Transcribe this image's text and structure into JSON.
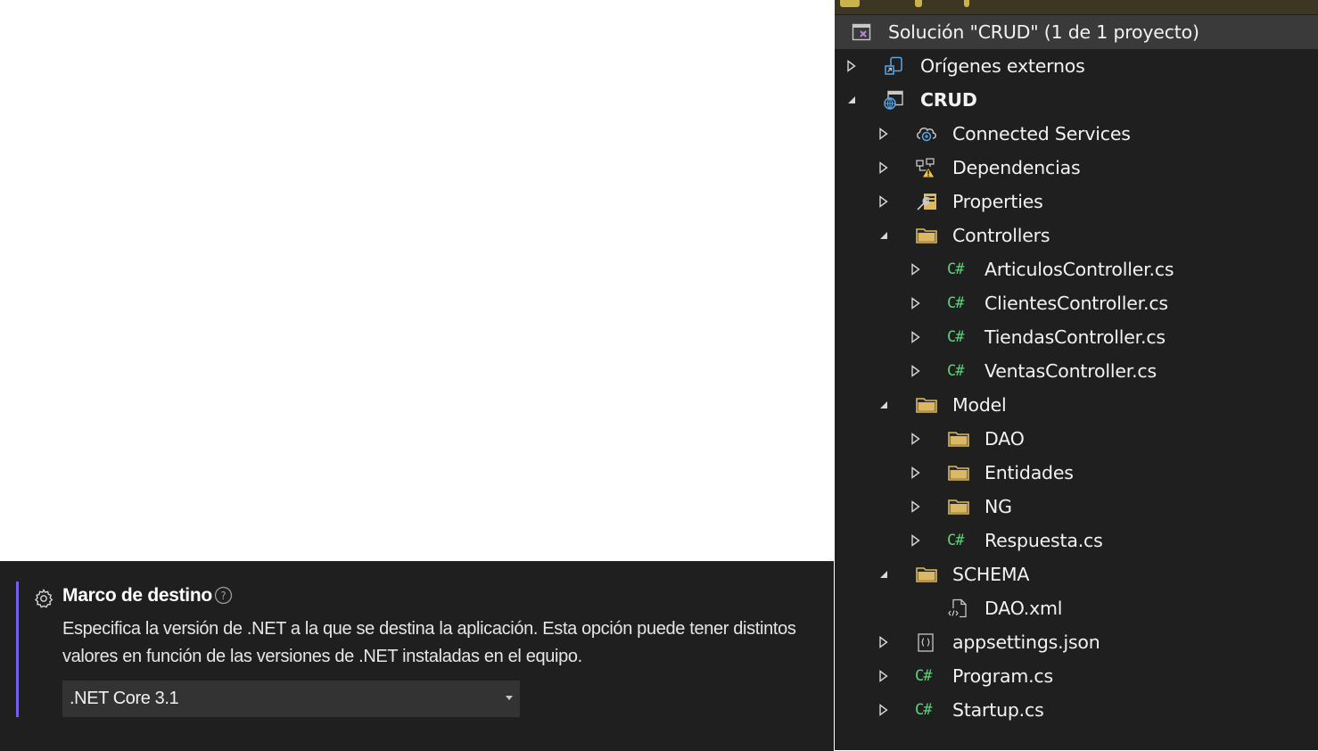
{
  "framework": {
    "title": "Marco de destino",
    "description_line1": "Especifica la versión de .NET a la que se destina la aplicación. Esta opción puede tener distintos",
    "description_line2": "valores en función de las versiones de .NET instaladas en el equipo.",
    "selected_value": ".NET Core 3.1",
    "icons": {
      "settings": "gear-icon",
      "help": "help-icon",
      "dropdown": "chevron-down-icon"
    },
    "colors": {
      "accent": "#7160e8",
      "background": "#1f1f1f",
      "select_bg": "#333333"
    }
  },
  "solution_explorer": {
    "colors": {
      "background": "#1f1f1f",
      "selected_row": "#3a3a3a",
      "folder": "#dcb862",
      "csharp": "#5fd17a"
    },
    "tree": [
      {
        "label": "Solución \"CRUD\"  (1 de 1 proyecto)",
        "icon": "solution-icon",
        "expander": "none",
        "bold": false,
        "selected": true
      },
      {
        "label": "Orígenes externos",
        "icon": "external-sources-icon",
        "expander": "collapsed",
        "bold": false
      },
      {
        "label": "CRUD",
        "icon": "web-project-icon",
        "expander": "expanded",
        "bold": true
      },
      {
        "label": "Connected Services",
        "icon": "connected-services-icon",
        "expander": "collapsed",
        "bold": false
      },
      {
        "label": "Dependencias",
        "icon": "dependencies-warning-icon",
        "expander": "collapsed",
        "bold": false
      },
      {
        "label": "Properties",
        "icon": "properties-icon",
        "expander": "collapsed",
        "bold": false
      },
      {
        "label": "Controllers",
        "icon": "folder-icon",
        "expander": "expanded",
        "bold": false
      },
      {
        "label": "ArticulosController.cs",
        "icon": "csharp-file-icon",
        "icon_text": "C#",
        "expander": "collapsed",
        "bold": false
      },
      {
        "label": "ClientesController.cs",
        "icon": "csharp-file-icon",
        "icon_text": "C#",
        "expander": "collapsed",
        "bold": false
      },
      {
        "label": "TiendasController.cs",
        "icon": "csharp-file-icon",
        "icon_text": "C#",
        "expander": "collapsed",
        "bold": false
      },
      {
        "label": "VentasController.cs",
        "icon": "csharp-file-icon",
        "icon_text": "C#",
        "expander": "collapsed",
        "bold": false
      },
      {
        "label": "Model",
        "icon": "folder-icon",
        "expander": "expanded",
        "bold": false
      },
      {
        "label": "DAO",
        "icon": "folder-icon",
        "expander": "collapsed",
        "bold": false
      },
      {
        "label": "Entidades",
        "icon": "folder-icon",
        "expander": "collapsed",
        "bold": false
      },
      {
        "label": "NG",
        "icon": "folder-icon",
        "expander": "collapsed",
        "bold": false
      },
      {
        "label": "Respuesta.cs",
        "icon": "csharp-file-icon",
        "icon_text": "C#",
        "expander": "collapsed",
        "bold": false
      },
      {
        "label": "SCHEMA",
        "icon": "folder-icon",
        "expander": "expanded",
        "bold": false
      },
      {
        "label": "DAO.xml",
        "icon": "xml-file-icon",
        "expander": "none",
        "bold": false
      },
      {
        "label": "appsettings.json",
        "icon": "json-file-icon",
        "expander": "collapsed",
        "bold": false
      },
      {
        "label": "Program.cs",
        "icon": "csharp-file-icon",
        "icon_text": "C#",
        "expander": "collapsed",
        "bold": false
      },
      {
        "label": "Startup.cs",
        "icon": "csharp-file-icon",
        "icon_text": "C#",
        "expander": "collapsed",
        "bold": false
      }
    ]
  }
}
